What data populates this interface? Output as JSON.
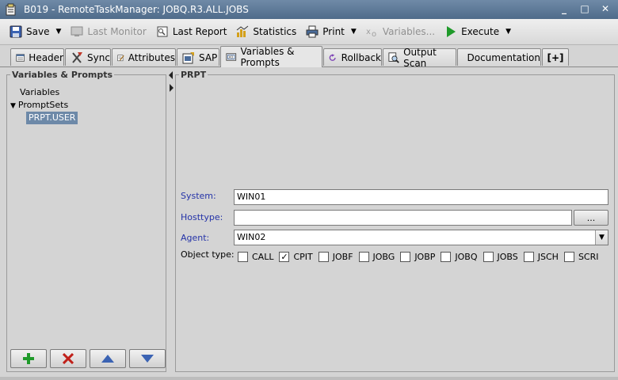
{
  "window": {
    "title": "B019 - RemoteTaskManager: JOBQ.R3.ALL.JOBS",
    "minimize": "_",
    "maximize": "□",
    "close": "✕"
  },
  "toolbar": {
    "save": "Save",
    "last_monitor": "Last Monitor",
    "last_report": "Last Report",
    "statistics": "Statistics",
    "print": "Print",
    "variables": "Variables...",
    "execute": "Execute"
  },
  "tabs": [
    {
      "label": "Header",
      "icon": "header-icon"
    },
    {
      "label": "Sync",
      "icon": "sync-icon"
    },
    {
      "label": "Attributes",
      "icon": "attributes-icon"
    },
    {
      "label": "SAP",
      "icon": "sap-icon"
    },
    {
      "label": "Variables & Prompts",
      "icon": "variables-icon"
    },
    {
      "label": "Rollback",
      "icon": "rollback-icon"
    },
    {
      "label": "Output Scan",
      "icon": "output-scan-icon"
    },
    {
      "label": "Documentation",
      "icon": "documentation-icon"
    },
    {
      "label": "[+]",
      "icon": "add-tab-icon"
    }
  ],
  "left_panel": {
    "title": "Variables & Prompts",
    "tree": {
      "variables": "Variables",
      "promptsets": "PromptSets",
      "selected_item": "PRPT.USER"
    }
  },
  "right_panel": {
    "title": "PRPT",
    "system": {
      "label": "System:",
      "value": "WIN01"
    },
    "hosttype": {
      "label": "Hosttype:",
      "value": "",
      "button": "..."
    },
    "agent": {
      "label": "Agent:",
      "value": "WIN02"
    },
    "object_type": {
      "label": "Object type:",
      "options": [
        {
          "label": "CALL",
          "checked": false
        },
        {
          "label": "CPIT",
          "checked": true
        },
        {
          "label": "JOBF",
          "checked": false
        },
        {
          "label": "JOBG",
          "checked": false
        },
        {
          "label": "JOBP",
          "checked": false
        },
        {
          "label": "JOBQ",
          "checked": false
        },
        {
          "label": "JOBS",
          "checked": false
        },
        {
          "label": "JSCH",
          "checked": false
        },
        {
          "label": "SCRI",
          "checked": false
        }
      ]
    }
  },
  "colors": {
    "title_bar": "#5a7594",
    "selection": "#6d89a8",
    "label_blue": "#2433a8"
  }
}
